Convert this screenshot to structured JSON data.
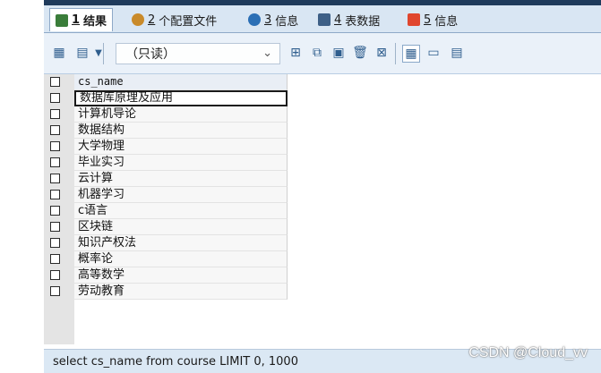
{
  "tabs": [
    {
      "num": "1",
      "label": " 结果"
    },
    {
      "num": "2",
      "label": " 个配置文件"
    },
    {
      "num": "3",
      "label": " 信息"
    },
    {
      "num": "4",
      "label": " 表数据"
    },
    {
      "num": "5",
      "label": " 信息"
    }
  ],
  "toolbar": {
    "readonly_label": "（只读）"
  },
  "grid": {
    "column_header": "cs_name",
    "rows": [
      "数据库原理及应用",
      "计算机导论",
      "数据结构",
      "大学物理",
      "毕业实习",
      "云计算",
      "机器学习",
      "c语言",
      "区块链",
      "知识产权法",
      "概率论",
      "高等数学",
      "劳动教育"
    ]
  },
  "status": {
    "query": "select cs_name from course LIMIT 0, 1000"
  },
  "watermark": "CSDN @Cloud_vv"
}
